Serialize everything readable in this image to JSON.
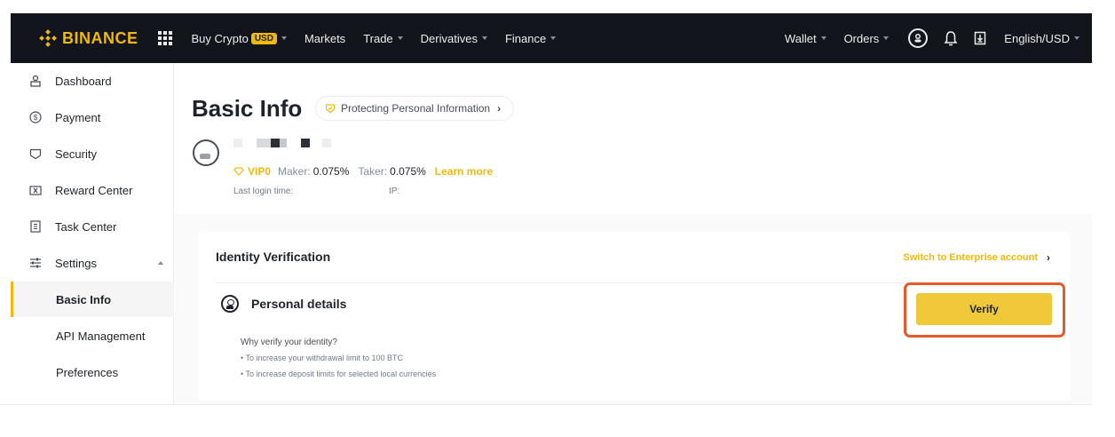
{
  "topnav": {
    "logo": "BINANCE",
    "items_left": [
      {
        "label": "Buy Crypto",
        "badge": "USD",
        "caret": true
      },
      {
        "label": "Markets",
        "caret": false
      },
      {
        "label": "Trade",
        "caret": true
      },
      {
        "label": "Derivatives",
        "caret": true
      },
      {
        "label": "Finance",
        "caret": true
      }
    ],
    "items_right": [
      {
        "label": "Wallet",
        "caret": true
      },
      {
        "label": "Orders",
        "caret": true
      }
    ],
    "language": "English/USD",
    "icons": [
      "profile-icon",
      "bell-icon",
      "download-icon"
    ]
  },
  "sidebar": {
    "items": [
      {
        "label": "Dashboard",
        "icon": "dashboard-icon"
      },
      {
        "label": "Payment",
        "icon": "payment-icon"
      },
      {
        "label": "Security",
        "icon": "security-icon"
      },
      {
        "label": "Reward Center",
        "icon": "reward-icon"
      },
      {
        "label": "Task Center",
        "icon": "task-icon"
      },
      {
        "label": "Settings",
        "icon": "settings-icon"
      }
    ],
    "sub_items": [
      {
        "label": "Basic Info",
        "active": true
      },
      {
        "label": "API Management",
        "active": false
      },
      {
        "label": "Preferences",
        "active": false
      }
    ]
  },
  "main": {
    "title": "Basic Info",
    "protect_link": "Protecting Personal Information",
    "vip": {
      "level": "VIP0",
      "maker_label": "Maker:",
      "maker_value": "0.075%",
      "taker_label": "Taker:",
      "taker_value": "0.075%",
      "learn_more": "Learn more"
    },
    "last_login_label": "Last login time:",
    "ip_label": "IP:"
  },
  "card": {
    "title": "Identity Verification",
    "enterprise_link": "Switch to Enterprise account",
    "section_title": "Personal details",
    "verify_label": "Verify",
    "why_title": "Why verify your identity?",
    "reasons": [
      "• To increase your withdrawal limit to 100 BTC",
      "• To increase deposit limits for selected local currencies"
    ]
  },
  "colors": {
    "accent": "#f0b90b",
    "button": "#f0c93a",
    "highlight": "#e8592a",
    "nav_bg": "#12161c"
  }
}
